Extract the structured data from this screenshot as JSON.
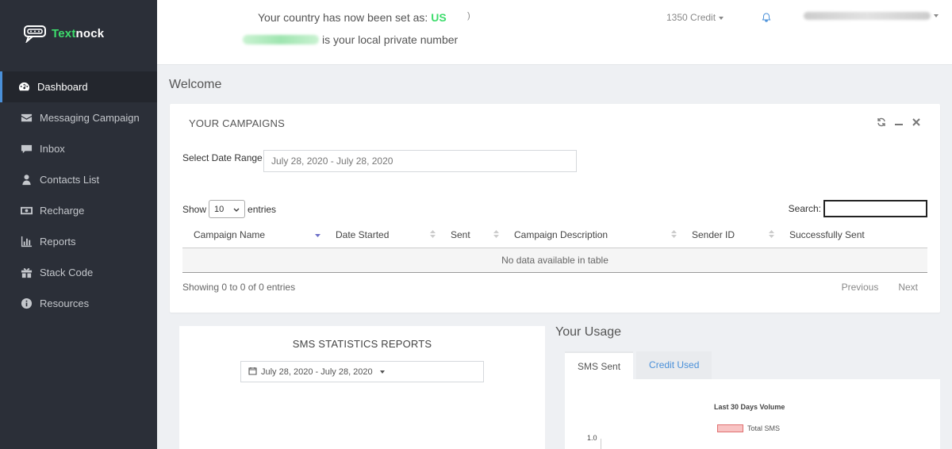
{
  "brand": {
    "logo_prefix": "Text",
    "logo_suffix": "nock"
  },
  "sidebar": {
    "items": [
      {
        "label": "Dashboard",
        "icon": "dashboard-icon",
        "active": true
      },
      {
        "label": "Messaging Campaign",
        "icon": "envelope-icon",
        "active": false
      },
      {
        "label": "Inbox",
        "icon": "chat-icon",
        "active": false
      },
      {
        "label": "Contacts List",
        "icon": "user-icon",
        "active": false
      },
      {
        "label": "Recharge",
        "icon": "money-icon",
        "active": false
      },
      {
        "label": "Reports",
        "icon": "bar-chart-icon",
        "active": false
      },
      {
        "label": "Stack Code",
        "icon": "gift-icon",
        "active": false
      },
      {
        "label": "Resources",
        "icon": "info-icon",
        "active": false
      }
    ]
  },
  "header": {
    "country_text": "Your country has now been set as:",
    "country_code": "US",
    "paren": ")",
    "number_suffix": "is your local private number",
    "credit": "1350 Credit"
  },
  "main": {
    "welcome": "Welcome",
    "campaigns": {
      "title": "YOUR CAMPAIGNS",
      "date_label": "Select Date Range",
      "date_value": "July 28, 2020 - July 28, 2020",
      "show_label": "Show",
      "entries_value": "10",
      "entries_label": "entries",
      "search_label": "Search:",
      "columns": [
        "Campaign Name",
        "Date Started",
        "Sent",
        "Campaign Description",
        "Sender ID",
        "Successfully Sent"
      ],
      "empty_text": "No data available in table",
      "info": "Showing 0 to 0 of 0 entries",
      "prev": "Previous",
      "next": "Next"
    },
    "sms_stats": {
      "title": "SMS STATISTICS REPORTS",
      "date_value": "July 28, 2020 - July 28, 2020"
    },
    "usage": {
      "title": "Your Usage",
      "tabs": [
        "SMS Sent",
        "Credit Used"
      ],
      "chart_title": "Last 30 Days Volume",
      "legend": "Total SMS",
      "ytick": "1.0"
    }
  },
  "colors": {
    "accent_green": "#3ddc6c",
    "link_blue": "#4a90d9",
    "sidebar_bg": "#2b2f38"
  }
}
